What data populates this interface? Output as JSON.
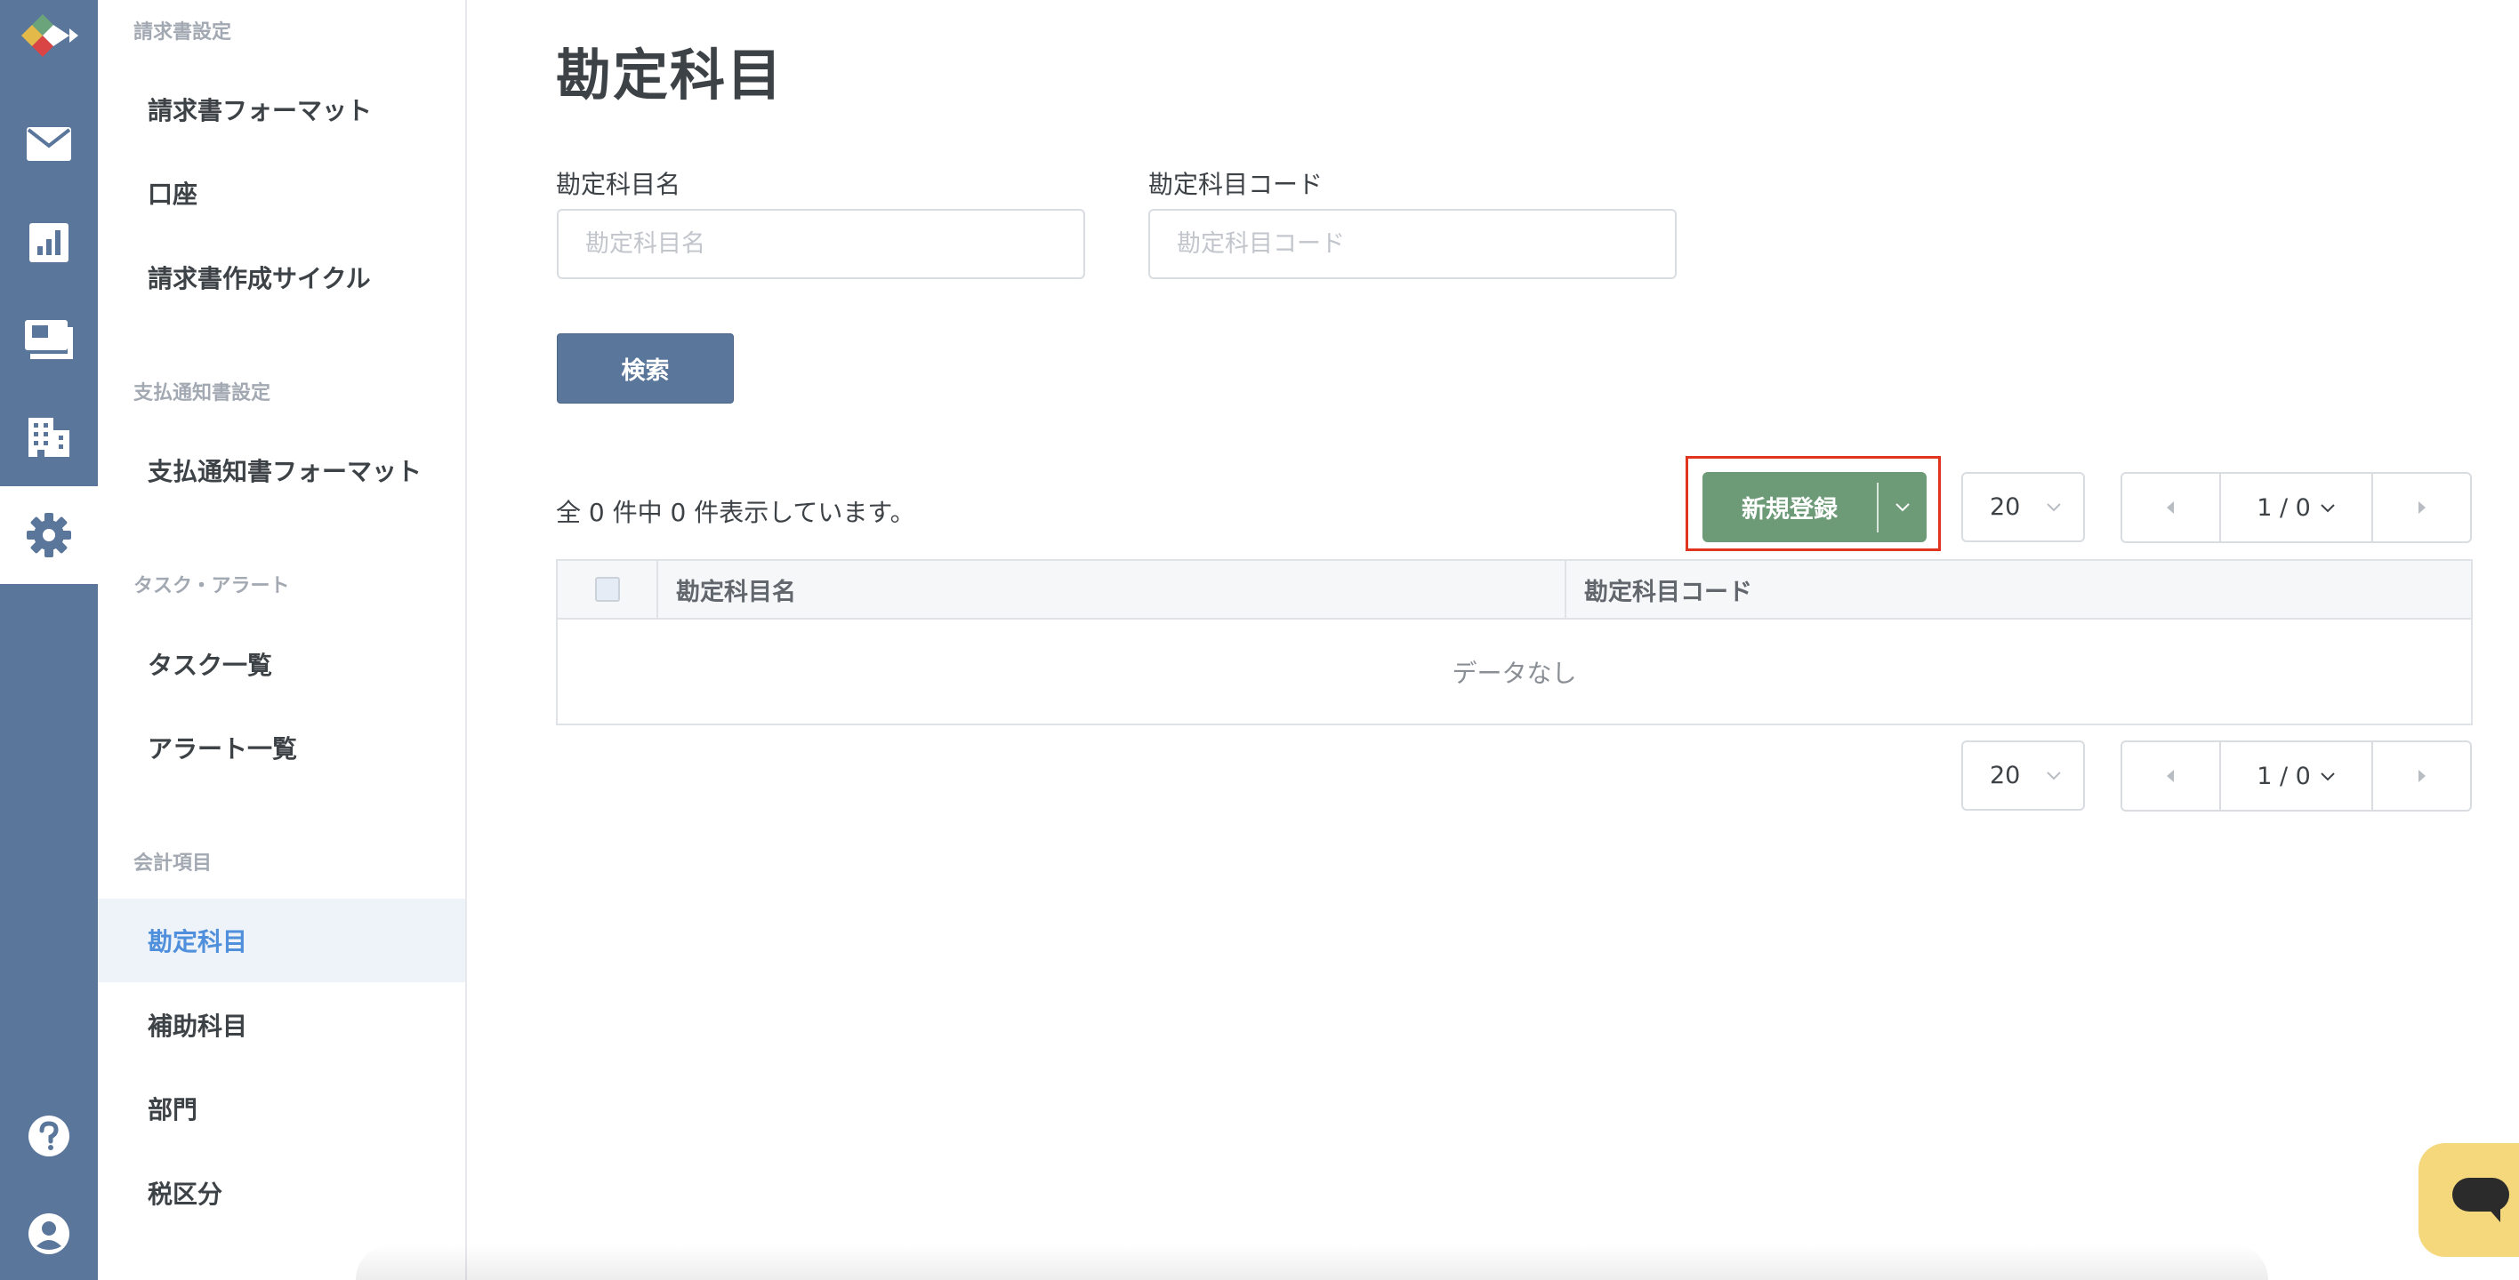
{
  "rail": {
    "icons": [
      "logo-icon",
      "mail-icon",
      "chart-icon",
      "payment-icon",
      "building-icon",
      "gear-icon",
      "help-icon",
      "account-icon"
    ],
    "active": "gear-icon",
    "color": "#5a769b"
  },
  "sidebar": {
    "sections": [
      {
        "title": "請求書設定",
        "items": [
          "請求書フォーマット",
          "口座",
          "請求書作成サイクル"
        ]
      },
      {
        "title": "支払通知書設定",
        "items": [
          "支払通知書フォーマット"
        ]
      },
      {
        "title": "タスク・アラート",
        "items": [
          "タスク一覧",
          "アラート一覧"
        ]
      },
      {
        "title": "会計項目",
        "items": [
          "勘定科目",
          "補助科目",
          "部門",
          "税区分"
        ]
      }
    ],
    "active_item": "勘定科目"
  },
  "page": {
    "title": "勘定科目"
  },
  "search": {
    "name_label": "勘定科目名",
    "name_placeholder": "勘定科目名",
    "name_value": "",
    "code_label": "勘定科目コード",
    "code_placeholder": "勘定科目コード",
    "code_value": "",
    "button": "検索"
  },
  "results": {
    "summary": "全 0 件中 0 件表示しています。",
    "new_button": "新規登録",
    "per_page": "20",
    "page_indicator": "1 / 0",
    "columns": [
      "勘定科目名",
      "勘定科目コード"
    ],
    "empty_text": "データなし"
  },
  "colors": {
    "primary": "#5a769b",
    "success": "#6d9b78",
    "highlight": "#e0341f",
    "active_link": "#4f8fdb",
    "chat": "#f5d77c"
  }
}
